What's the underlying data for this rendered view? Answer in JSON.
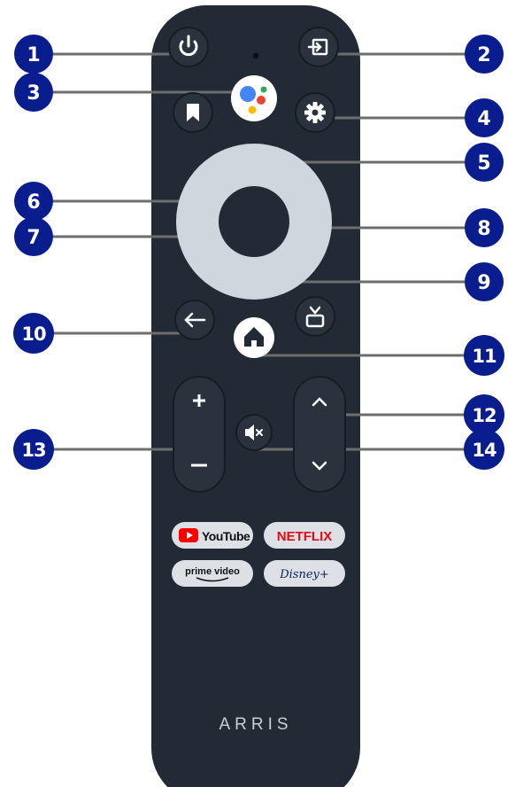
{
  "brand": "ARRIS",
  "colors": {
    "remote_body": "#222b35",
    "button": "#2a333d",
    "dpad": "#cfd6de",
    "callout": "#0a1d8f",
    "leader": "#6d6d6d",
    "youtube_red": "#ff0000",
    "netflix_red": "#e50914",
    "pill_bg": "#dde1e6"
  },
  "buttons": {
    "power": {
      "icon": "power-icon"
    },
    "input": {
      "icon": "input-icon"
    },
    "assistant": {
      "icon": "google-assistant-icon"
    },
    "bookmark": {
      "icon": "bookmark-icon"
    },
    "settings": {
      "icon": "gear-icon"
    },
    "back": {
      "icon": "back-arrow-icon"
    },
    "tv": {
      "icon": "tv-icon"
    },
    "home": {
      "icon": "home-icon"
    },
    "volume_up": "+",
    "volume_down": "–",
    "mute": {
      "icon": "mute-icon"
    },
    "channel_up": {
      "icon": "chevron-up-icon"
    },
    "channel_down": {
      "icon": "chevron-down-icon"
    }
  },
  "apps": {
    "youtube": "YouTube",
    "netflix": "NETFLIX",
    "prime": "prime video",
    "disney": "Disney+"
  },
  "callouts": [
    "1",
    "2",
    "3",
    "4",
    "5",
    "6",
    "7",
    "8",
    "9",
    "10",
    "11",
    "12",
    "13",
    "14"
  ]
}
